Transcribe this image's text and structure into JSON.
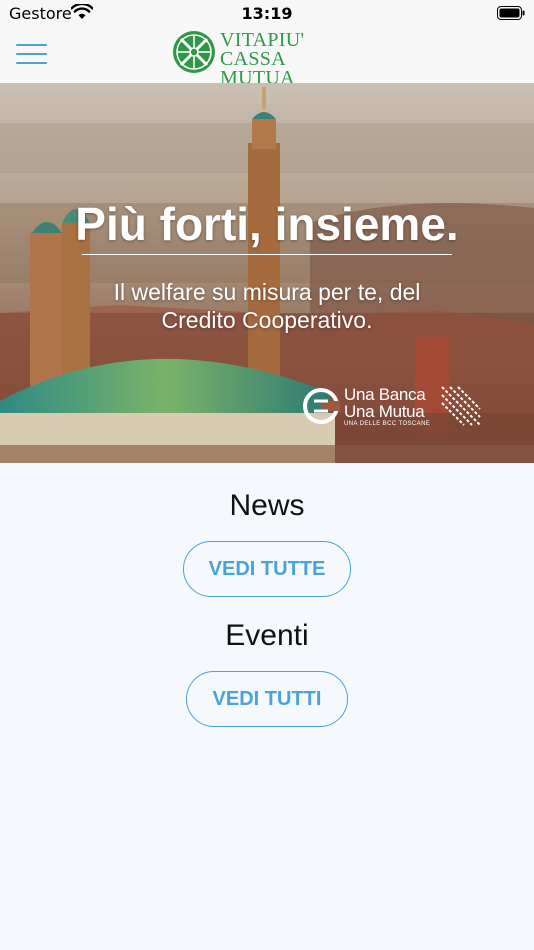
{
  "status_bar": {
    "carrier": "Gestore",
    "time": "13:19"
  },
  "header": {
    "logo_line1": "VITAPIU'",
    "logo_line2": "CASSA MUTUA",
    "brand_color": "#2f9847",
    "accent_color": "#4aa3d8"
  },
  "hero": {
    "title": "Più forti, insieme.",
    "subtitle_line1": "Il welfare su misura per te, del",
    "subtitle_line2": "Credito Cooperativo.",
    "promo_line1": "Una Banca",
    "promo_line2": "Una Mutua",
    "promo_small": "UNA DELLE BCC TOSCANE"
  },
  "news": {
    "title": "News",
    "button_label": "VEDI TUTTE"
  },
  "events": {
    "title": "Eventi",
    "button_label": "VEDI TUTTI"
  }
}
